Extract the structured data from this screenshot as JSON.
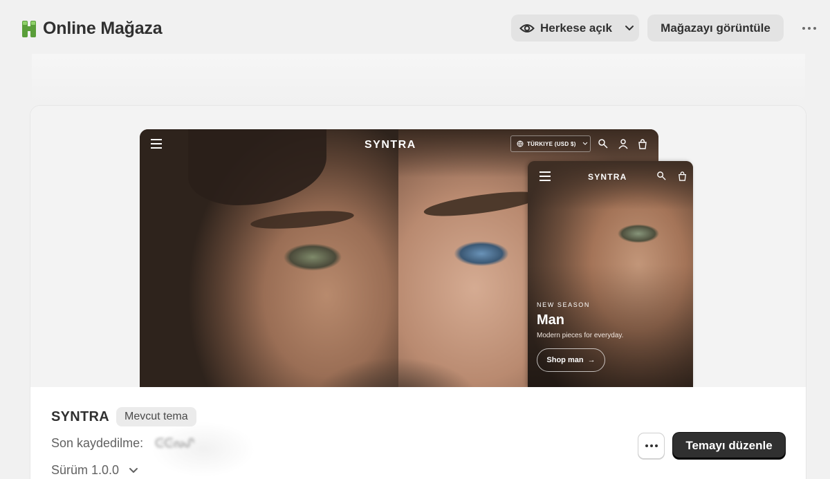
{
  "header": {
    "title": "Online Mağaza",
    "visibility_label": "Herkese açık",
    "view_store_label": "Mağazayı görüntüle"
  },
  "preview": {
    "desktop": {
      "logo": "SYNTRA",
      "country_selector": "TÜRKIYE (USD $)"
    },
    "mobile": {
      "logo": "SYNTRA",
      "eyebrow": "NEW SEASON",
      "title": "Man",
      "subtitle": "Modern pieces for everyday.",
      "cta_label": "Shop man",
      "cta_arrow": "→"
    }
  },
  "theme": {
    "name": "SYNTRA",
    "badge": "Mevcut tema",
    "last_saved_label": "Son kaydedilme:",
    "last_saved_value": "ᕮᕮᔓᔑ",
    "version_label": "Sürüm 1.0.0",
    "edit_label": "Temayı düzenle"
  },
  "colors": {
    "brand_green": "#5a9e3a",
    "primary_button": "#303030",
    "background": "#f1f1f1"
  }
}
